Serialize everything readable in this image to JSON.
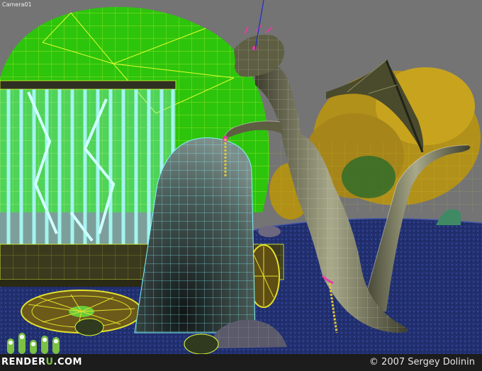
{
  "viewport": {
    "label": "Camera01"
  },
  "branding": {
    "logo_prefix": "RENDER",
    "logo_accent": "U",
    "logo_suffix": ".COM",
    "copyright": "© 2007 Sergey Dolinin"
  },
  "colors": {
    "background": "#727272",
    "dome": "#2ec40b",
    "ground": "#283a7a",
    "cage_bars": "#9ff0ea",
    "tree": "#c9a21c",
    "dragon": "#8a8a6a",
    "stone": "#4a5a56",
    "wireframe_yellow": "#d8d800",
    "logo_green": "#7bc143"
  }
}
